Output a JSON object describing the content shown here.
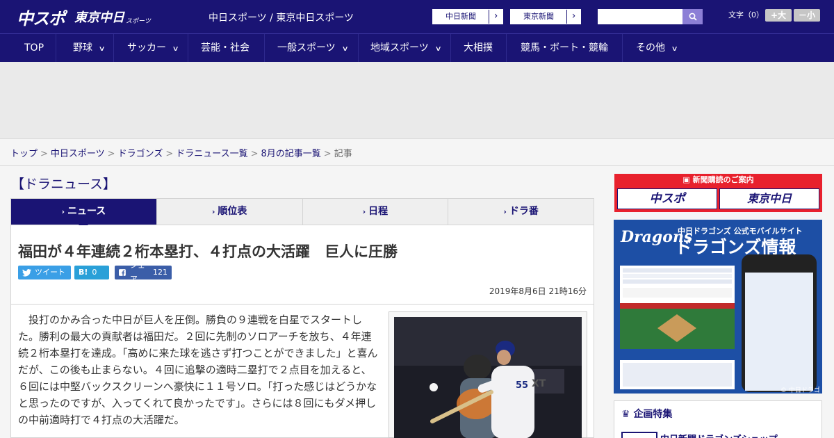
{
  "header": {
    "logo_main": "中スポ",
    "logo_tokyo": "東京中日",
    "logo_small": "スポーツ",
    "site_name": "中日スポーツ / 東京中日スポーツ",
    "link_chunichi": "中日新聞",
    "link_tokyo": "東京新聞",
    "link_arrow": "›",
    "search_placeholder": "",
    "font_label": "文字（0）",
    "font_large": "+大",
    "font_small": "－小"
  },
  "nav": [
    {
      "label": "TOP",
      "has_menu": false
    },
    {
      "label": "野球",
      "has_menu": true
    },
    {
      "label": "サッカー",
      "has_menu": true
    },
    {
      "label": "芸能・社会",
      "has_menu": false
    },
    {
      "label": "一般スポーツ",
      "has_menu": true
    },
    {
      "label": "地域スポーツ",
      "has_menu": true
    },
    {
      "label": "大相撲",
      "has_menu": false
    },
    {
      "label": "競馬・ボート・競輪",
      "has_menu": false
    },
    {
      "label": "その他",
      "has_menu": true
    }
  ],
  "breadcrumb": [
    "トップ",
    "中日スポーツ",
    "ドラゴンズ",
    "ドラニュース一覧",
    "8月の記事一覧",
    "記事"
  ],
  "section_title": "【ドラニュース】",
  "tabs": [
    {
      "label": "ニュース",
      "active": true
    },
    {
      "label": "順位表",
      "active": false
    },
    {
      "label": "日程",
      "active": false
    },
    {
      "label": "ドラ番",
      "active": false
    }
  ],
  "article": {
    "headline": "福田が４年連続２桁本塁打、４打点の大活躍　巨人に圧勝",
    "share_tweet": "ツイート",
    "share_hatena_icon": "B!",
    "share_hatena_count": "0",
    "share_facebook": "シェア",
    "share_facebook_count": "121",
    "date": "2019年8月6日 21時16分",
    "body": "　投打のかみ合った中日が巨人を圧倒。勝負の９連戦を白星でスタートした。勝利の最大の貢献者は福田だ。２回に先制のソロアーチを放ち、４年連続２桁本塁打を達成。「高めに来た球を逃さず打つことができました」と喜んだが、この後も止まらない。４回に追撃の適時二塁打で２点目を加えると、６回には中堅バックスクリーンへ豪快に１１号ソロ。「打った感じはどうかなと思ったのですが、入ってくれて良かったです」。さらには８回にもダメ押しの中前適時打で４打点の大活躍だ。"
  },
  "sidebar": {
    "subscribe_caption": "新聞購読のご案内",
    "subscribe_chuspo": "中スポ",
    "subscribe_tokyo": "東京中日",
    "app_brand": "Dragons",
    "app_sub": "中日ドラゴンズ 公式モバイルサイト",
    "app_title": "ドラゴンズ情報",
    "app_copyright": "© 中日ドラゴンズ",
    "feature_title": "企画特集",
    "feature_item": "中日新聞ドラゴンズショップ"
  },
  "colors": {
    "brand": "#1a1474",
    "accent_red": "#e8212d",
    "twitter": "#3a9fe6",
    "hatena": "#2aa0d8",
    "facebook": "#3b5ea8"
  }
}
